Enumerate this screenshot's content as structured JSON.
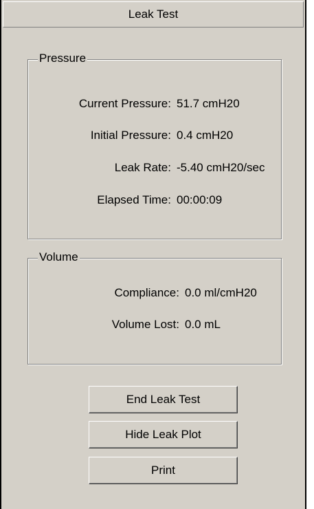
{
  "window": {
    "title": "Leak Test"
  },
  "pressure": {
    "legend": "Pressure",
    "rows": [
      {
        "label": "Current Pressure:",
        "value": "51.7 cmH20"
      },
      {
        "label": "Initial Pressure:",
        "value": "0.4 cmH20"
      },
      {
        "label": "Leak Rate:",
        "value": "-5.40 cmH20/sec"
      },
      {
        "label": "Elapsed Time:",
        "value": "00:00:09"
      }
    ]
  },
  "volume": {
    "legend": "Volume",
    "rows": [
      {
        "label": "Compliance:",
        "value": "0.0 ml/cmH20"
      },
      {
        "label": "Volume Lost:",
        "value": "0.0 mL"
      }
    ]
  },
  "buttons": {
    "end_leak_test": "End Leak Test",
    "hide_leak_plot": "Hide Leak Plot",
    "print": "Print"
  },
  "colors": {
    "panel_background": "#d4d0c8",
    "border": "#000000",
    "text": "#000000"
  }
}
